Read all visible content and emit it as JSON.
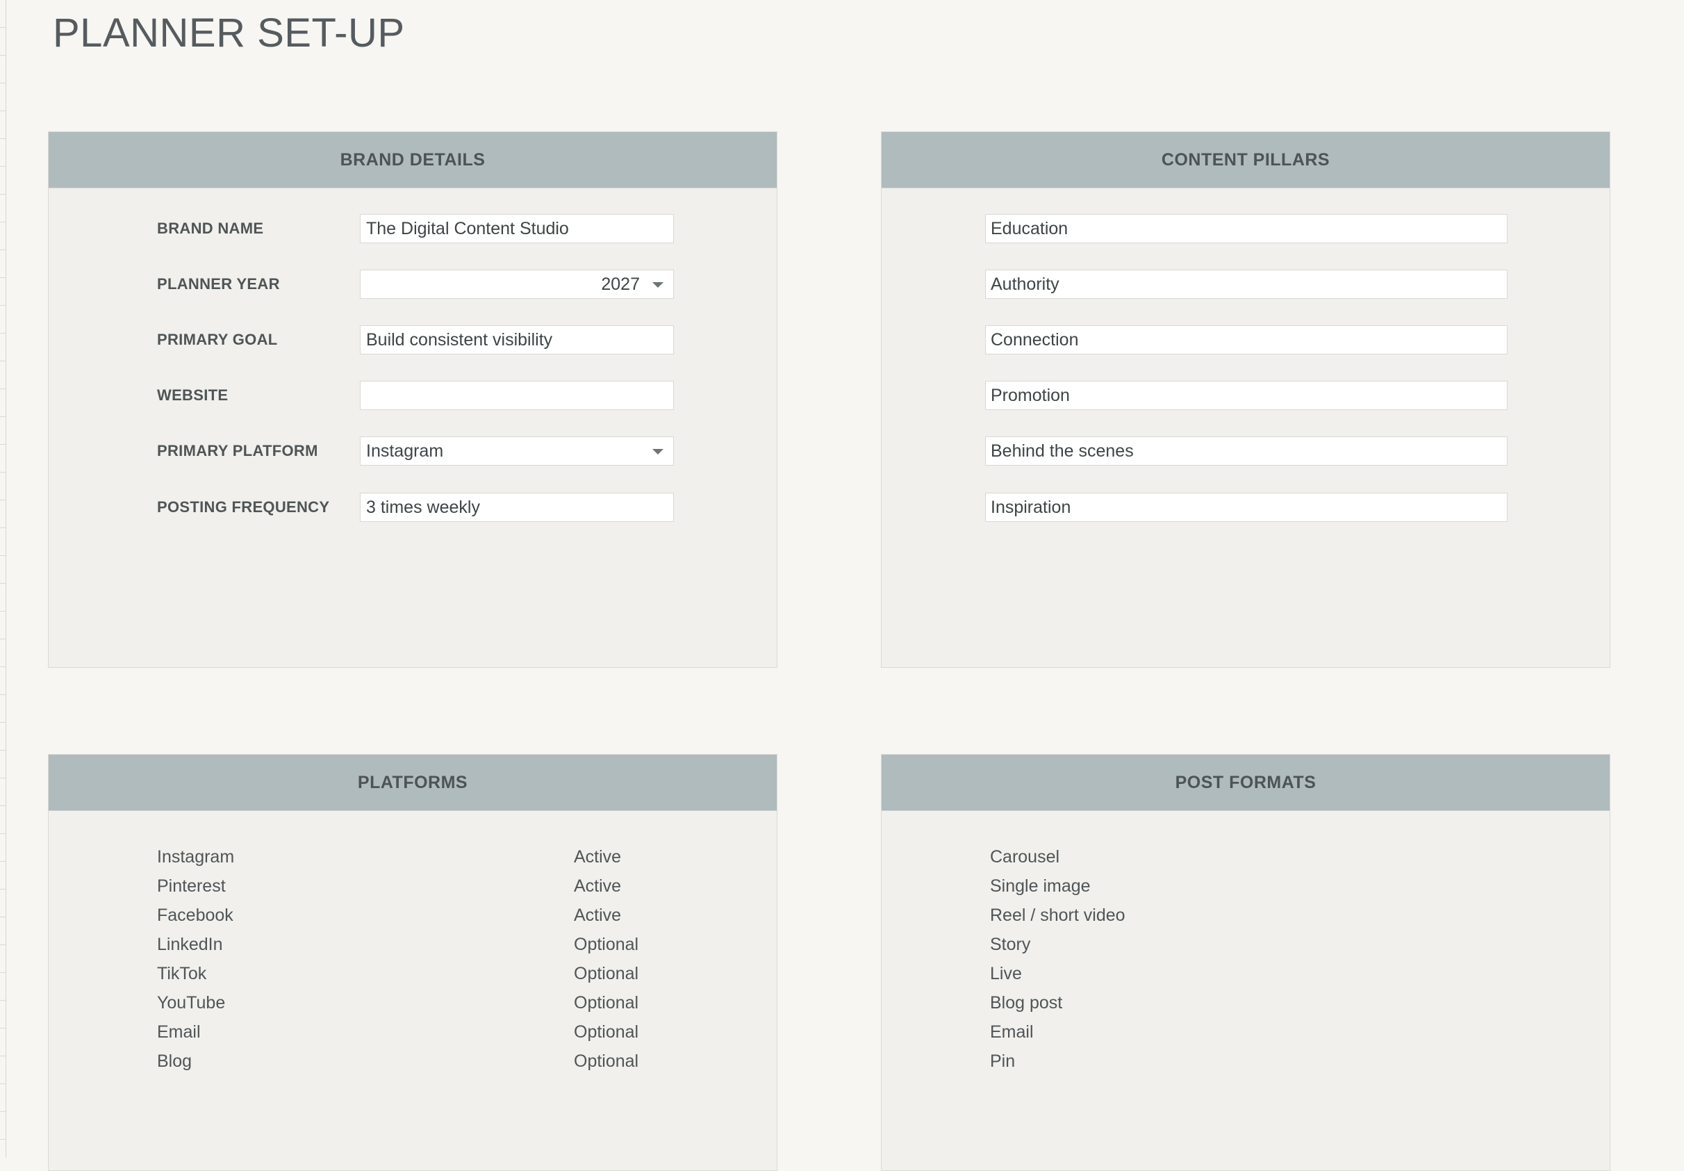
{
  "page_title": "PLANNER SET-UP",
  "brand_details": {
    "title": "BRAND DETAILS",
    "fields": [
      {
        "label": "BRAND NAME",
        "value": "The Digital Content Studio",
        "type": "text"
      },
      {
        "label": "PLANNER YEAR",
        "value": "2027",
        "type": "select"
      },
      {
        "label": "PRIMARY GOAL",
        "value": "Build consistent visibility",
        "type": "text"
      },
      {
        "label": "WEBSITE",
        "value": "",
        "type": "text"
      },
      {
        "label": "PRIMARY PLATFORM",
        "value": "Instagram",
        "type": "select"
      },
      {
        "label": "POSTING FREQUENCY",
        "value": "3 times weekly",
        "type": "text"
      }
    ]
  },
  "content_pillars": {
    "title": "CONTENT PILLARS",
    "items": [
      "Education",
      "Authority",
      "Connection",
      "Promotion",
      "Behind the scenes",
      "Inspiration"
    ]
  },
  "platforms": {
    "title": "PLATFORMS",
    "items": [
      {
        "name": "Instagram",
        "status": "Active"
      },
      {
        "name": "Pinterest",
        "status": "Active"
      },
      {
        "name": "Facebook",
        "status": "Active"
      },
      {
        "name": "LinkedIn",
        "status": "Optional"
      },
      {
        "name": "TikTok",
        "status": "Optional"
      },
      {
        "name": "YouTube",
        "status": "Optional"
      },
      {
        "name": "Email",
        "status": "Optional"
      },
      {
        "name": "Blog",
        "status": "Optional"
      }
    ]
  },
  "post_formats": {
    "title": "POST FORMATS",
    "items": [
      "Carousel",
      "Single image",
      "Reel / short video",
      "Story",
      "Live",
      "Blog post",
      "Email",
      "Pin"
    ]
  },
  "icons": {
    "dropdown": "chevron-down-icon"
  },
  "colors": {
    "background": "#f7f6f2",
    "card": "#f1f0ec",
    "header": "#afbbbd",
    "text": "#4f5557"
  }
}
